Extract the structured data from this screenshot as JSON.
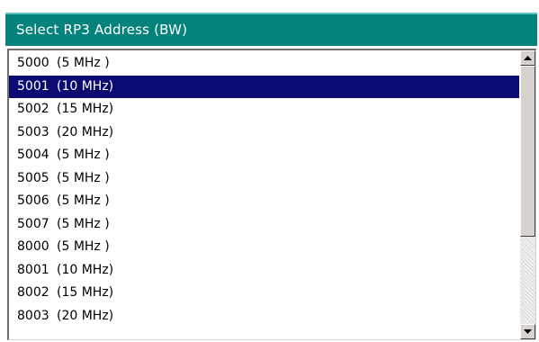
{
  "dialog": {
    "title": "Select RP3 Address  (BW)"
  },
  "list": {
    "items": [
      {
        "address": "5000",
        "bandwidth": "(5 MHz )"
      },
      {
        "address": "5001",
        "bandwidth": "(10 MHz)"
      },
      {
        "address": "5002",
        "bandwidth": "(15 MHz)"
      },
      {
        "address": "5003",
        "bandwidth": "(20 MHz)"
      },
      {
        "address": "5004",
        "bandwidth": "(5 MHz )"
      },
      {
        "address": "5005",
        "bandwidth": "(5 MHz )"
      },
      {
        "address": "5006",
        "bandwidth": "(5 MHz )"
      },
      {
        "address": "5007",
        "bandwidth": "(5 MHz )"
      },
      {
        "address": "8000",
        "bandwidth": "(5 MHz )"
      },
      {
        "address": "8001",
        "bandwidth": "(10 MHz)"
      },
      {
        "address": "8002",
        "bandwidth": "(15 MHz)"
      },
      {
        "address": "8003",
        "bandwidth": "(20 MHz)"
      }
    ],
    "selected_index": 1
  },
  "scrollbar": {
    "up_icon": "triangle-up-icon",
    "down_icon": "triangle-down-icon",
    "position_fraction": 0
  },
  "colors": {
    "title_bg": "#05827b",
    "selection_bg": "#0b0b73",
    "selection_fg": "#ffffff"
  }
}
